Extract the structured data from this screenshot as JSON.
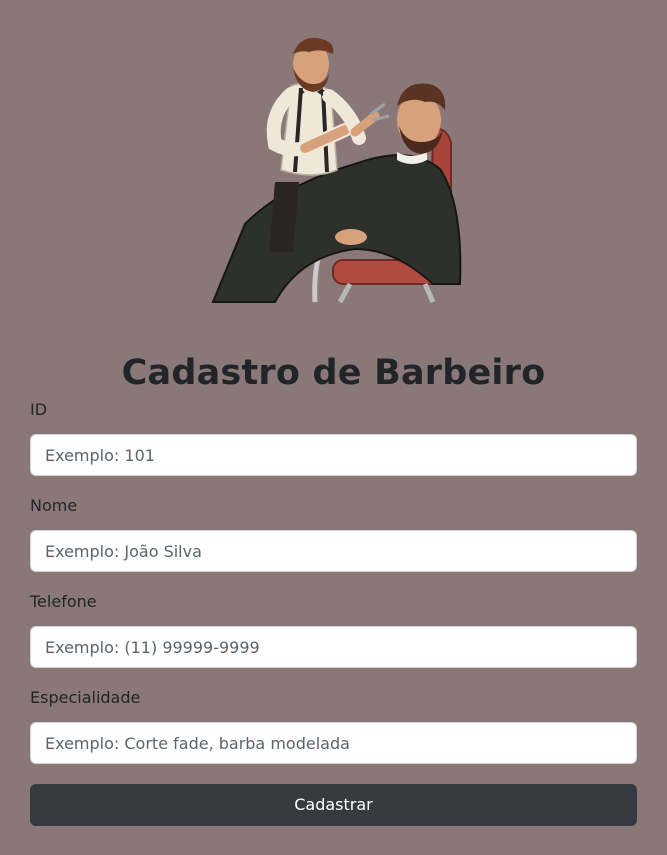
{
  "page": {
    "title": "Cadastro de Barbeiro"
  },
  "hero": {
    "icon": "barber-illustration"
  },
  "form": {
    "fields": [
      {
        "label": "ID",
        "placeholder": "Exemplo: 101",
        "value": ""
      },
      {
        "label": "Nome",
        "placeholder": "Exemplo: João Silva",
        "value": ""
      },
      {
        "label": "Telefone",
        "placeholder": "Exemplo: (11) 99999-9999",
        "value": ""
      },
      {
        "label": "Especialidade",
        "placeholder": "Exemplo: Corte fade, barba modelada",
        "value": ""
      }
    ],
    "submit_label": "Cadastrar"
  },
  "colors": {
    "background": "#8a7878",
    "button": "#343a40",
    "text": "#212529"
  }
}
